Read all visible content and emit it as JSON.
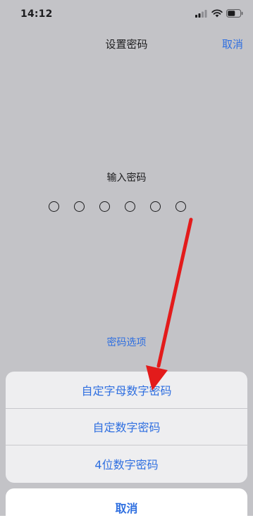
{
  "status_bar": {
    "time": "14:12",
    "signal_icon": "cellular-signal-icon",
    "wifi_icon": "wifi-icon",
    "battery_icon": "battery-icon"
  },
  "nav": {
    "title": "设置密码",
    "cancel_label": "取消"
  },
  "passcode": {
    "prompt": "输入密码",
    "length": 6,
    "filled": 0
  },
  "options_link": "密码选项",
  "action_sheet": {
    "items": [
      {
        "label": "自定字母数字密码"
      },
      {
        "label": "自定数字密码"
      },
      {
        "label": "4位数字密码"
      }
    ],
    "cancel_label": "取消"
  },
  "annotation": {
    "type": "arrow",
    "color": "#e31b1b"
  },
  "colors": {
    "background": "#c3c3c7",
    "accent": "#2f6fe0",
    "sheet_background": "#eeeef0"
  }
}
